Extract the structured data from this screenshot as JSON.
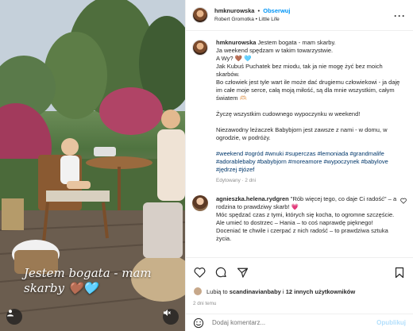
{
  "photo": {
    "caption": "Jestem bogata - mam skarby 🤎🩵",
    "icons": [
      "user-tag-icon",
      "mute-icon"
    ]
  },
  "header": {
    "username": "hmknurowska",
    "separator": "•",
    "follow_label": "Obserwuj",
    "audio_artist": "Robert Gromotka",
    "audio_sep": "•",
    "audio_title": "Little Life",
    "more_label": "···"
  },
  "post": {
    "username": "hmknurowska",
    "para1": "Jestem bogata - mam skarby.\nJa weekend spędzam w takim towarzystwie.\nA Wy? 🤎 🩵\nJak Kubuś Puchatek bez miodu, tak ja nie mogę żyć bez moich skarbów.\nBo człowiek jest tyle wart ile może dać drugiemu człowiekowi - ja daję im całe moje serce, całą moją miłość, są dla mnie wszystkim, całym światem 🫶🏻",
    "para2": "Życzę wszystkim cudownego wypoczynku w weekend!",
    "para3": "Niezawodny leżaczek Babybjorn jest zawsze z nami - w domu, w ogrodzie, w podróży.",
    "tags": "#weekend #ogród #wnuki #superczas #lemoniada #grandmalife #adorablebaby #babybjorn #moreamore #wypoczynek #babylove #jędrzej #józef",
    "edited": "Edytowany · 2 dni"
  },
  "comment": {
    "username": "agnieszka.helena.rydgren",
    "text": "\"Rób więcej tego, co daje Ci radość\" – a rodzina to prawdziwy skarb! 💗\nMóc spędzać czas z tymi, których się kocha, to ogromne szczęście. Ale umieć to dostrzec – Hania – to coś naprawdę pięknego!\nDoceniać te chwile i czerpać z nich radość – to prawdziwa sztuka życia."
  },
  "actions": {
    "icons": [
      "heart-icon",
      "comment-icon",
      "share-icon",
      "bookmark-icon"
    ],
    "likes_prefix": "Lubią to",
    "likes_user": "scandinavianbaby",
    "likes_and": "i",
    "likes_others": "12 innych użytkowników",
    "date": "2 dni temu"
  },
  "add_comment": {
    "placeholder": "Dodaj komentarz...",
    "post_label": "Opublikuj"
  }
}
